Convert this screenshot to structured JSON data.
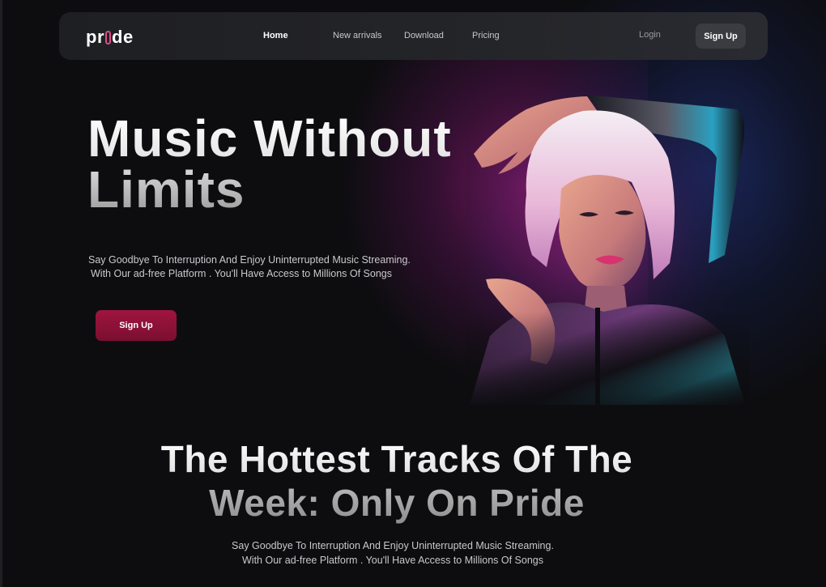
{
  "nav": {
    "logo": {
      "pre": "pr",
      "post": "de"
    },
    "links": [
      "Home",
      "New arrivals",
      "Download",
      "Pricing"
    ],
    "login": "Login",
    "signup": "Sign Up"
  },
  "hero": {
    "title_line1": "Music Without",
    "title_line2": "Limits",
    "subtitle_line1": "Say Goodbye To Interruption And Enjoy Uninterrupted Music Streaming.",
    "subtitle_line2": "With Our ad-free Platform . You'll Have Access to Millions Of Songs",
    "cta": "Sign Up"
  },
  "section": {
    "title_line1": "The Hottest Tracks Of The",
    "title_line2": "Week: Only On Pride",
    "subtitle_line1": "Say Goodbye To Interruption And Enjoy Uninterrupted Music Streaming.",
    "subtitle_line2": "With Our ad-free Platform . You'll Have Access to Millions Of Songs"
  },
  "colors": {
    "background": "#0d0d10",
    "accent": "#a0153f",
    "glow_pink": "#c81e96",
    "glow_blue": "#2846b4"
  }
}
